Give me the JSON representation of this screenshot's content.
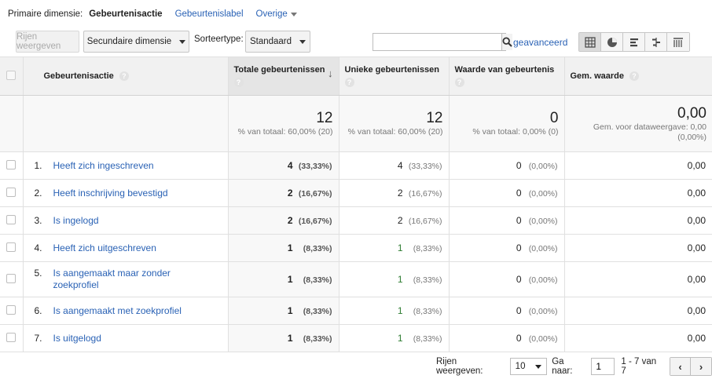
{
  "dimension_bar": {
    "label": "Primaire dimensie:",
    "active": "Gebeurtenisactie",
    "alt": "Gebeurtenislabel",
    "other": "Overige"
  },
  "toolbar": {
    "rows_button": "Rijen weergeven",
    "secondary_dimension": "Secundaire dimensie",
    "sort_label": "Sorteertype:",
    "sort_value": "Standaard",
    "search_value": "",
    "advanced": "geavanceerd"
  },
  "table": {
    "headers": {
      "action": "Gebeurtenisactie",
      "total": "Totale gebeurtenissen",
      "unique": "Unieke gebeurtenissen",
      "value": "Waarde van gebeurtenis",
      "avg": "Gem. waarde",
      "help": "?"
    },
    "totals": {
      "total": "12",
      "total_sub": "% van totaal: 60,00% (20)",
      "unique": "12",
      "unique_sub": "% van totaal: 60,00% (20)",
      "value": "0",
      "value_sub": "% van totaal: 0,00% (0)",
      "avg": "0,00",
      "avg_sub": "Gem. voor dataweergave: 0,00 (0,00%)"
    },
    "rows": [
      {
        "idx": "1.",
        "name": "Heeft zich ingeschreven",
        "total": "4",
        "total_pct": "(33,33%)",
        "unique": "4",
        "unique_pct": "(33,33%)",
        "value": "0",
        "value_pct": "(0,00%)",
        "avg": "0,00"
      },
      {
        "idx": "2.",
        "name": "Heeft inschrijving bevestigd",
        "total": "2",
        "total_pct": "(16,67%)",
        "unique": "2",
        "unique_pct": "(16,67%)",
        "value": "0",
        "value_pct": "(0,00%)",
        "avg": "0,00"
      },
      {
        "idx": "3.",
        "name": "Is ingelogd",
        "total": "2",
        "total_pct": "(16,67%)",
        "unique": "2",
        "unique_pct": "(16,67%)",
        "value": "0",
        "value_pct": "(0,00%)",
        "avg": "0,00"
      },
      {
        "idx": "4.",
        "name": "Heeft zich uitgeschreven",
        "total": "1",
        "total_pct": "(8,33%)",
        "unique": "1",
        "unique_pct": "(8,33%)",
        "value": "0",
        "value_pct": "(0,00%)",
        "avg": "0,00"
      },
      {
        "idx": "5.",
        "name": "Is aangemaakt maar zonder zoekprofiel",
        "total": "1",
        "total_pct": "(8,33%)",
        "unique": "1",
        "unique_pct": "(8,33%)",
        "value": "0",
        "value_pct": "(0,00%)",
        "avg": "0,00"
      },
      {
        "idx": "6.",
        "name": "Is aangemaakt met zoekprofiel",
        "total": "1",
        "total_pct": "(8,33%)",
        "unique": "1",
        "unique_pct": "(8,33%)",
        "value": "0",
        "value_pct": "(0,00%)",
        "avg": "0,00"
      },
      {
        "idx": "7.",
        "name": "Is uitgelogd",
        "total": "1",
        "total_pct": "(8,33%)",
        "unique": "1",
        "unique_pct": "(8,33%)",
        "value": "0",
        "value_pct": "(0,00%)",
        "avg": "0,00"
      }
    ]
  },
  "pagination": {
    "rows_label": "Rijen weergeven:",
    "rows_value": "10",
    "goto_label": "Ga naar:",
    "goto_value": "1",
    "range": "1 - 7 van 7",
    "prev": "‹",
    "next": "›"
  },
  "colors": {
    "link": "#2a62b5",
    "header_bg": "#f1f1f1",
    "unique_value": "#2e7d32"
  },
  "icons": [
    "search-icon",
    "table-view-icon",
    "pie-view-icon",
    "performance-view-icon",
    "comparison-view-icon",
    "pivot-view-icon",
    "help-icon",
    "sort-down-icon",
    "chevron-left-icon",
    "chevron-right-icon",
    "dropdown-caret-icon"
  ]
}
